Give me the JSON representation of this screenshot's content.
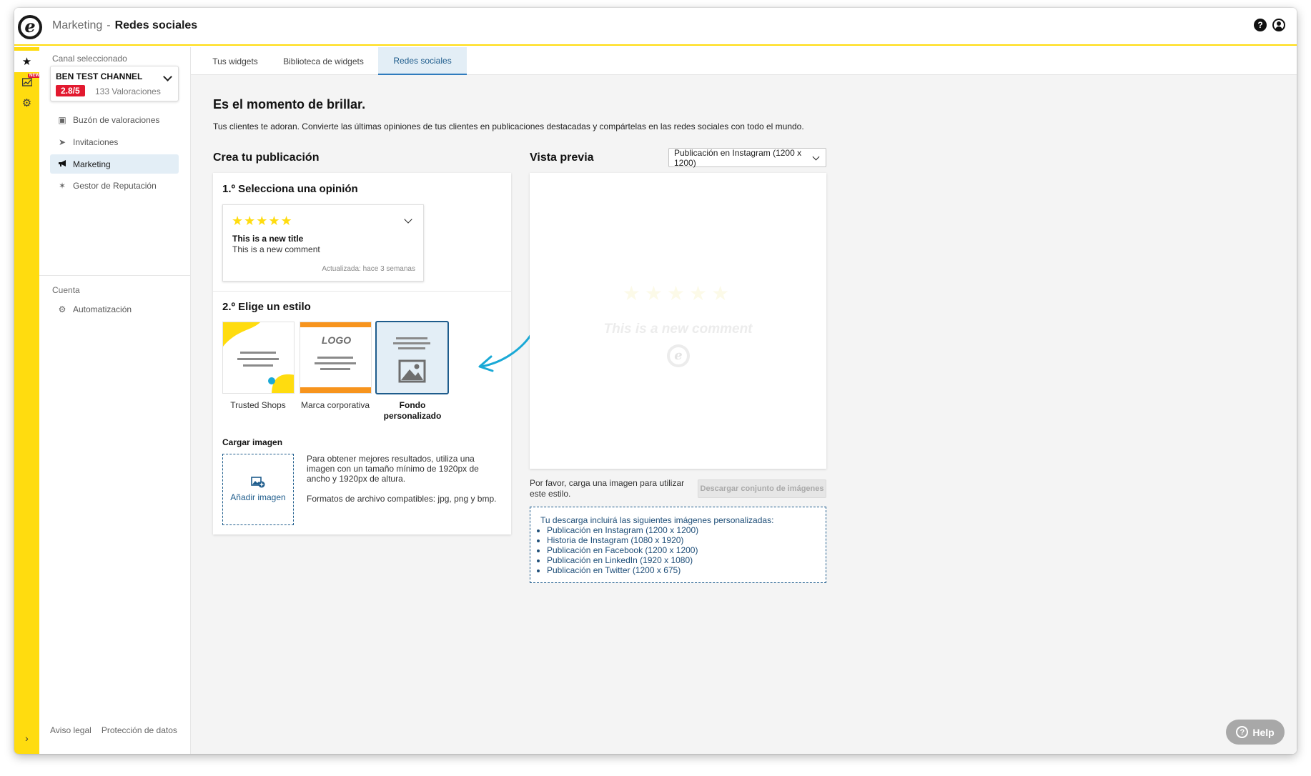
{
  "header": {
    "logo_letter": "e",
    "breadcrumb_parent": "Marketing",
    "breadcrumb_separator": "-",
    "breadcrumb_current": "Redes sociales",
    "help_icon": "question-icon",
    "user_icon": "user-icon"
  },
  "rail": {
    "items": [
      "star-icon",
      "chart-new-icon",
      "gear-icon"
    ],
    "new_badge": "NEW",
    "toggle_icon": "chevron-right-icon"
  },
  "sidebar": {
    "channel_label": "Canal seleccionado",
    "channel_name": "BEN TEST CHANNEL",
    "channel_rating": "2.8/5",
    "channel_reviews": "133 Valoraciones",
    "nav": [
      {
        "label": "Buzón de valoraciones",
        "icon": "inbox-icon"
      },
      {
        "label": "Invitaciones",
        "icon": "send-icon"
      },
      {
        "label": "Marketing",
        "icon": "megaphone-icon"
      },
      {
        "label": "Gestor de Reputación",
        "icon": "sparkle-icon"
      }
    ],
    "account_label": "Cuenta",
    "account_nav": [
      {
        "label": "Automatización",
        "icon": "robot-icon"
      }
    ],
    "footer": {
      "legal": "Aviso legal",
      "privacy": "Protección de datos"
    }
  },
  "tabs": [
    {
      "label": "Tus widgets"
    },
    {
      "label": "Biblioteca de widgets"
    },
    {
      "label": "Redes sociales",
      "active": true
    }
  ],
  "main": {
    "title": "Es el momento de brillar.",
    "subtitle": "Tus clientes te adoran. Convierte las últimas opiniones de tus clientes en publicaciones destacadas y compártelas en las redes sociales con todo el mundo.",
    "create_title": "Crea tu publicación",
    "step1_title": "1.º Selecciona una opinión",
    "review": {
      "stars": "★★★★★",
      "title": "This is a new title",
      "comment": "This is a new comment",
      "updated": "Actualizada: hace 3 semanas"
    },
    "step2_title": "2.º Elige un estilo",
    "styles": [
      {
        "label": "Trusted Shops"
      },
      {
        "label": "Marca corporativa",
        "logo_text": "LOGO"
      },
      {
        "label": "Fondo personalizado",
        "selected": true
      }
    ],
    "upload": {
      "title": "Cargar imagen",
      "button": "Añadir imagen",
      "info_1": "Para obtener mejores resultados, utiliza una imagen con un tamaño mínimo de 1920px de ancho y 1920px de altura.",
      "info_2": "Formatos de archivo compatibles: jpg, png y bmp."
    },
    "preview": {
      "title": "Vista previa",
      "select_value": "Publicación en Instagram (1200 x 1200)",
      "stars": "★★★★★",
      "comment": "This is a new comment",
      "note": "Por favor, carga una imagen para utilizar este estilo.",
      "download_button": "Descargar conjunto de imágenes",
      "download_intro": "Tu descarga incluirá las siguientes imágenes personalizadas:",
      "download_items": [
        "Publicación en Instagram (1200 x 1200)",
        "Historia de Instagram (1080 x 1920)",
        "Publicación en Facebook (1200 x 1200)",
        "Publicación en LinkedIn (1920 x 1080)",
        "Publicación en Twitter (1200 x 675)"
      ]
    }
  },
  "help_button": "Help",
  "colors": {
    "brand_yellow": "#ffdc0f",
    "accent_blue": "#1e5c8c",
    "rating_red": "#e2192f",
    "arrow_cyan": "#1aa9d6",
    "style_orange": "#f7941d"
  }
}
